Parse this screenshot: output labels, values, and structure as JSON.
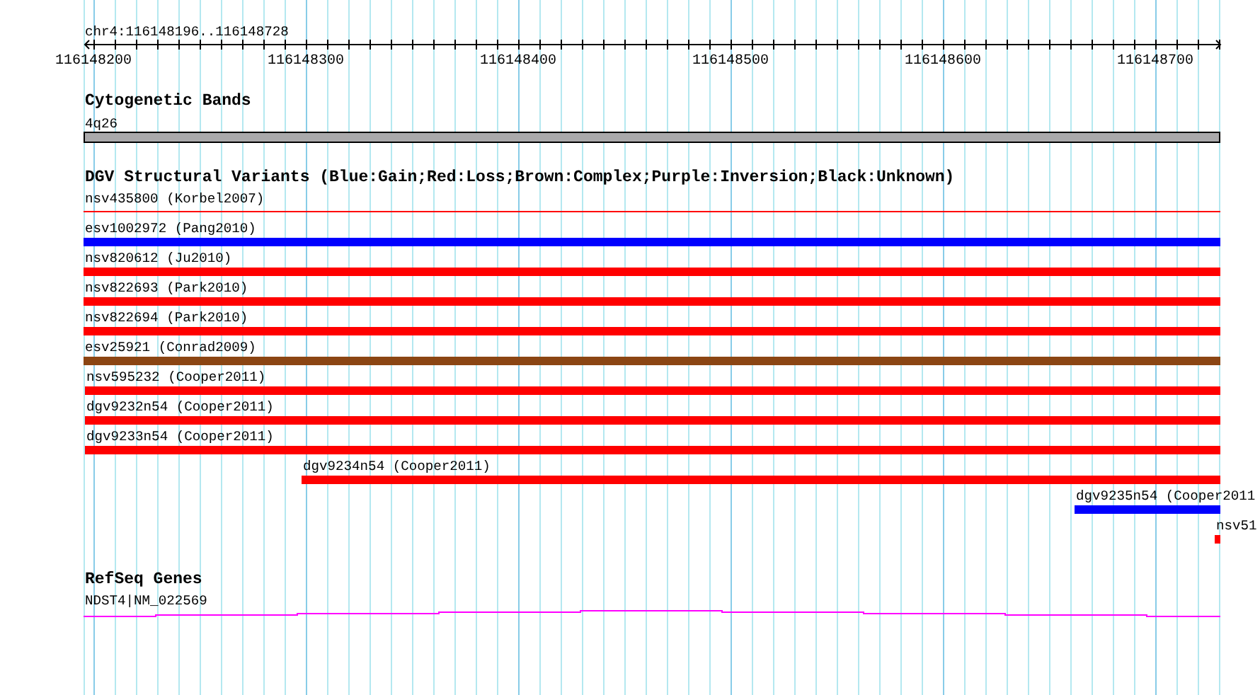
{
  "ruler": {
    "region": "chr4:116148196..116148728",
    "tick_labels": [
      "116148200",
      "116148300",
      "116148400",
      "116148500",
      "116148600",
      "116148700"
    ]
  },
  "tracks": [
    {
      "kind": "cytoband",
      "title": "Cytogenetic Bands",
      "features": [
        {
          "label": "4q26"
        }
      ]
    },
    {
      "kind": "variants",
      "title": "DGV Structural Variants (Blue:Gain;Red:Loss;Brown:Complex;Purple:Inversion;Black:Unknown)",
      "features": [
        {
          "label": "nsv435800 (Korbel2007)",
          "kind": "line",
          "color": "#ff0000"
        },
        {
          "label": "esv1002972 (Pang2010)",
          "kind": "bar",
          "color": "#0000ff"
        },
        {
          "label": "nsv820612 (Ju2010)",
          "kind": "bar",
          "color": "#ff0000"
        },
        {
          "label": "nsv822693 (Park2010)",
          "kind": "bar",
          "color": "#ff0000"
        },
        {
          "label": "nsv822694 (Park2010)",
          "kind": "bar",
          "color": "#ff0000"
        },
        {
          "label": "esv25921 (Conrad2009)",
          "kind": "bar",
          "color": "#8b4513"
        },
        {
          "label": "nsv595232 (Cooper2011)",
          "kind": "bar",
          "color": "#ff0000"
        },
        {
          "label": "dgv9232n54 (Cooper2011)",
          "kind": "bar",
          "color": "#ff0000"
        },
        {
          "label": "dgv9233n54 (Cooper2011)",
          "kind": "bar",
          "color": "#ff0000"
        },
        {
          "label": "dgv9234n54 (Cooper2011)",
          "kind": "bar",
          "color": "#ff0000"
        },
        {
          "label": "dgv9235n54 (Cooper2011",
          "kind": "bar",
          "color": "#0000ff"
        },
        {
          "label": "nsv51",
          "kind": "bar",
          "color": "#ff0000"
        }
      ]
    },
    {
      "kind": "gene",
      "title": "RefSeq Genes",
      "features": [
        {
          "label": "NDST4|NM_022569"
        }
      ]
    }
  ]
}
